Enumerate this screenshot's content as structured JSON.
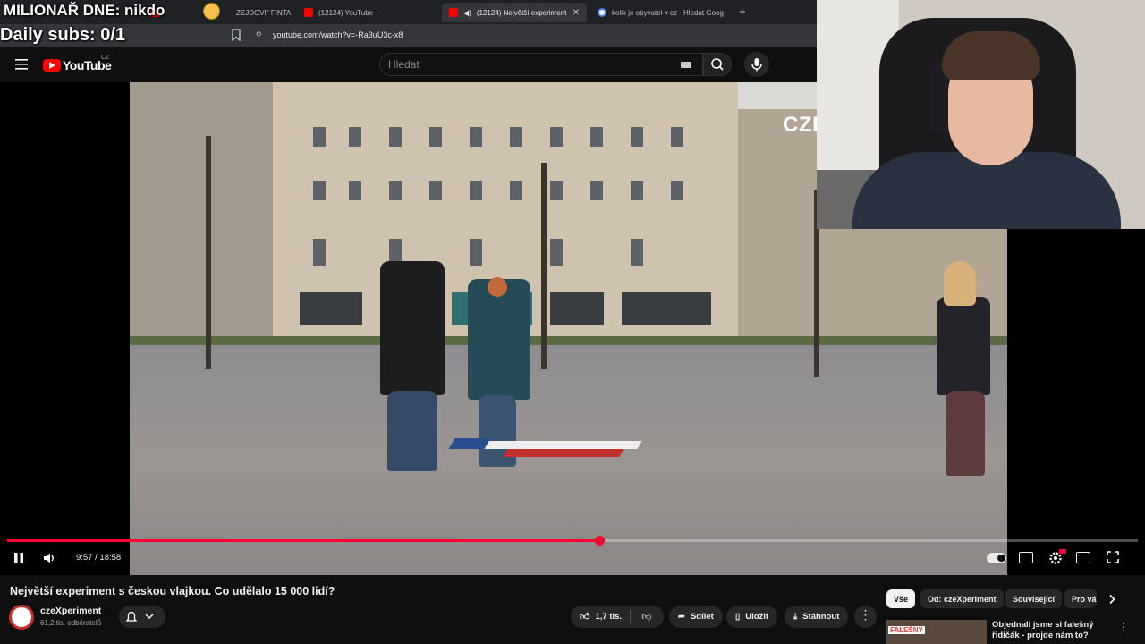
{
  "stream_overlay": {
    "title": "MILIONAŘ DNE: nikdo",
    "subs": "Daily subs: 0/1"
  },
  "browser": {
    "tabs": [
      {
        "label": "ZEJDOVI\" FINTA od",
        "favicon": "youtube-icon",
        "active": false
      },
      {
        "label": "(12124) YouTube",
        "favicon": "youtube-icon",
        "active": false
      },
      {
        "label": "(12124) Největší experiment",
        "favicon": "youtube-icon",
        "active": true
      },
      {
        "label": "kolik je obyvatel v cz - Hledat Goog",
        "favicon": "google-icon",
        "active": false
      }
    ],
    "new_tab": "+",
    "url": "youtube.com/watch?v=-Ra3uU3c-x8"
  },
  "youtube": {
    "logo_text": "YouTube",
    "region": "CZ",
    "search_placeholder": "Hledat"
  },
  "video": {
    "watermark": "CZE",
    "time_current": "9:57",
    "time_total": "18:58",
    "time_display": "9:57 / 18:58",
    "progress_fraction": 0.524,
    "title": "Největší experiment s českou vlajkou. Co udělalo 15 000 lidí?",
    "channel": "czeXperiment",
    "subscribers": "61,2 tis. odběratelů",
    "likes": "1,7 tis.",
    "share_label": "Sdílet",
    "save_label": "Uložit",
    "download_label": "Stáhnout",
    "more_label": "⋮"
  },
  "chips": [
    {
      "label": "Vše",
      "active": true
    },
    {
      "label": "Od: czeXperiment",
      "active": false
    },
    {
      "label": "Související",
      "active": false
    },
    {
      "label": "Pro vás",
      "active": false
    }
  ],
  "related": {
    "thumb_badge": "FALEŠNÝ",
    "title": "Objednali jsme si falešný řidičák - projde nám to?",
    "more_label": "⋮"
  },
  "colors": {
    "accent": "#ff0033",
    "background": "#0f0f0f"
  }
}
